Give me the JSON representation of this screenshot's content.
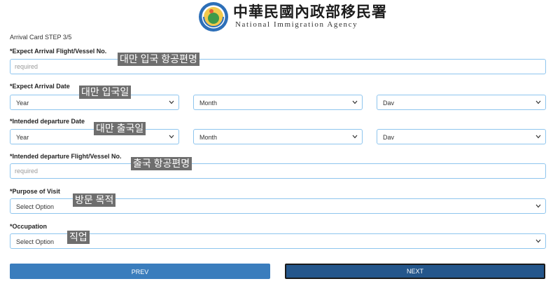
{
  "header": {
    "agency_zh": "中華民國內政部移民署",
    "agency_en": "National Immigration Agency",
    "logo_icon": "emblem-logo-icon"
  },
  "step_label": "Arrival Card STEP 3/5",
  "fields": {
    "arrival_flight": {
      "label": "*Expect Arrival Flight/Vessel No.",
      "placeholder": "required",
      "value": "",
      "note": "대만 입국 항공편명"
    },
    "arrival_date": {
      "label": "*Expect Arrival Date",
      "year": "Year",
      "month": "Month",
      "day": "Dav",
      "note": "대만 입국일"
    },
    "departure_date": {
      "label": "*Intended departure Date",
      "year": "Year",
      "month": "Month",
      "day": "Dav",
      "note": "대만 출국일"
    },
    "departure_flight": {
      "label": "*Intended departure Flight/Vessel No.",
      "placeholder": "required",
      "value": "",
      "note": "출국 항공편명"
    },
    "purpose": {
      "label": "*Purpose of Visit",
      "selected": "Select Option",
      "note": "방문 목적"
    },
    "occupation": {
      "label": "*Occupation",
      "selected": "Select Option",
      "note": "직업"
    }
  },
  "buttons": {
    "prev": "PREV",
    "next": "NEXT"
  },
  "colors": {
    "field_border": "#8ec5ee",
    "prev_button": "#3a7dbd",
    "next_button": "#24568b",
    "note_bg": "#6e6e6e"
  }
}
